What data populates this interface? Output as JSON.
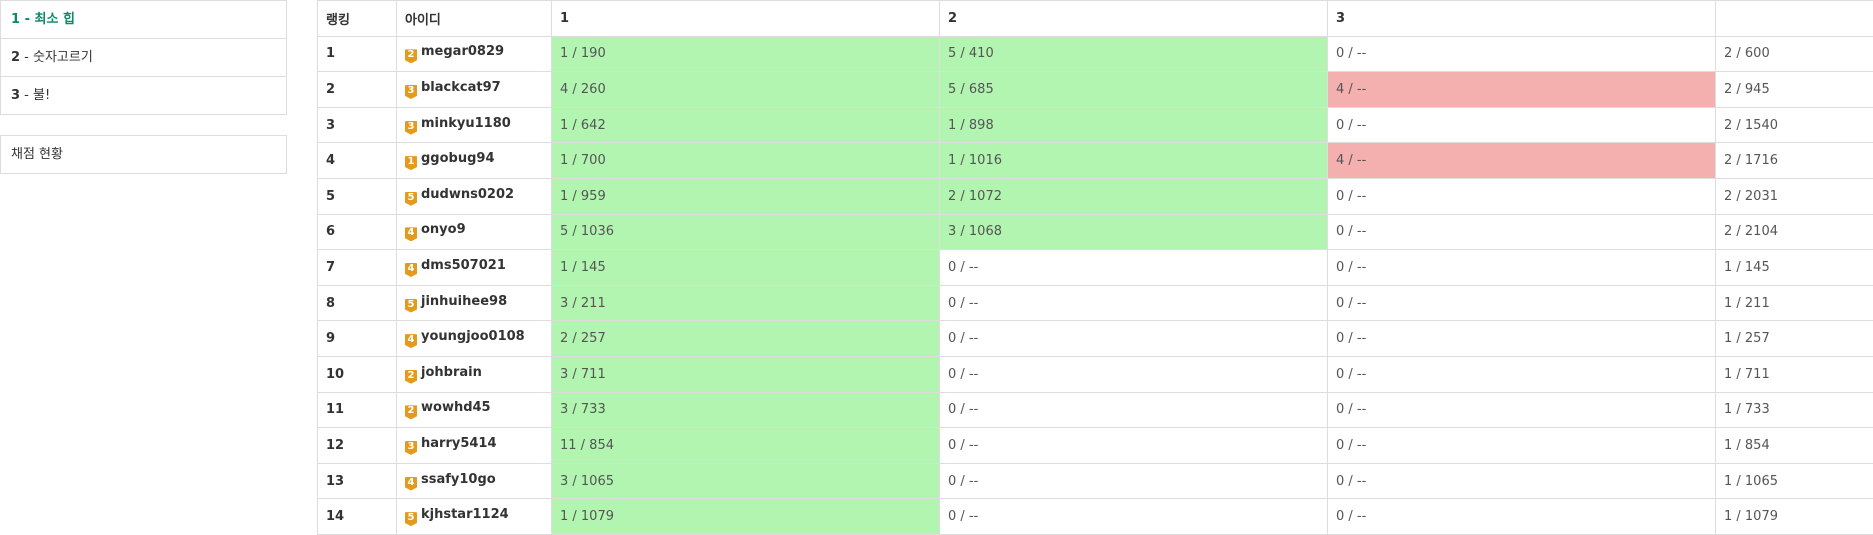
{
  "sidebar": {
    "problems": [
      {
        "num": "1",
        "sep": " - ",
        "label": "최소 힙"
      },
      {
        "num": "2",
        "sep": " - ",
        "label": "숫자고르기"
      },
      {
        "num": "3",
        "sep": " - ",
        "label": "불!"
      }
    ],
    "status_label": "채점 현황"
  },
  "table": {
    "headers": {
      "rank": "랭킹",
      "id": "아이디",
      "p1": "1",
      "p2": "2",
      "p3": "3",
      "total": ""
    },
    "rows": [
      {
        "rank": "1",
        "tier": "2",
        "id": "megar0829",
        "p1": "1 / 190",
        "p2": "5 / 410",
        "p3": "0 / --",
        "total": "2 / 600",
        "s1": "ok",
        "s2": "ok",
        "s3": ""
      },
      {
        "rank": "2",
        "tier": "3",
        "id": "blackcat97",
        "p1": "4 / 260",
        "p2": "5 / 685",
        "p3": "4 / --",
        "total": "2 / 945",
        "s1": "ok",
        "s2": "ok",
        "s3": "fail"
      },
      {
        "rank": "3",
        "tier": "3",
        "id": "minkyu1180",
        "p1": "1 / 642",
        "p2": "1 / 898",
        "p3": "0 / --",
        "total": "2 / 1540",
        "s1": "ok",
        "s2": "ok",
        "s3": ""
      },
      {
        "rank": "4",
        "tier": "1",
        "id": "ggobug94",
        "p1": "1 / 700",
        "p2": "1 / 1016",
        "p3": "4 / --",
        "total": "2 / 1716",
        "s1": "ok",
        "s2": "ok",
        "s3": "fail"
      },
      {
        "rank": "5",
        "tier": "5",
        "id": "dudwns0202",
        "p1": "1 / 959",
        "p2": "2 / 1072",
        "p3": "0 / --",
        "total": "2 / 2031",
        "s1": "ok",
        "s2": "ok",
        "s3": ""
      },
      {
        "rank": "6",
        "tier": "4",
        "id": "onyo9",
        "p1": "5 / 1036",
        "p2": "3 / 1068",
        "p3": "0 / --",
        "total": "2 / 2104",
        "s1": "ok",
        "s2": "ok",
        "s3": ""
      },
      {
        "rank": "7",
        "tier": "4",
        "id": "dms507021",
        "p1": "1 / 145",
        "p2": "0 / --",
        "p3": "0 / --",
        "total": "1 / 145",
        "s1": "ok",
        "s2": "",
        "s3": ""
      },
      {
        "rank": "8",
        "tier": "5",
        "id": "jinhuihee98",
        "p1": "3 / 211",
        "p2": "0 / --",
        "p3": "0 / --",
        "total": "1 / 211",
        "s1": "ok",
        "s2": "",
        "s3": ""
      },
      {
        "rank": "9",
        "tier": "4",
        "id": "youngjoo0108",
        "p1": "2 / 257",
        "p2": "0 / --",
        "p3": "0 / --",
        "total": "1 / 257",
        "s1": "ok",
        "s2": "",
        "s3": ""
      },
      {
        "rank": "10",
        "tier": "2",
        "id": "johbrain",
        "p1": "3 / 711",
        "p2": "0 / --",
        "p3": "0 / --",
        "total": "1 / 711",
        "s1": "ok",
        "s2": "",
        "s3": ""
      },
      {
        "rank": "11",
        "tier": "2",
        "id": "wowhd45",
        "p1": "3 / 733",
        "p2": "0 / --",
        "p3": "0 / --",
        "total": "1 / 733",
        "s1": "ok",
        "s2": "",
        "s3": ""
      },
      {
        "rank": "12",
        "tier": "3",
        "id": "harry5414",
        "p1": "11 / 854",
        "p2": "0 / --",
        "p3": "0 / --",
        "total": "1 / 854",
        "s1": "ok",
        "s2": "",
        "s3": ""
      },
      {
        "rank": "13",
        "tier": "4",
        "id": "ssafy10go",
        "p1": "3 / 1065",
        "p2": "0 / --",
        "p3": "0 / --",
        "total": "1 / 1065",
        "s1": "ok",
        "s2": "",
        "s3": ""
      },
      {
        "rank": "14",
        "tier": "5",
        "id": "kjhstar1124",
        "p1": "1 / 1079",
        "p2": "0 / --",
        "p3": "0 / --",
        "total": "1 / 1079",
        "s1": "ok",
        "s2": "",
        "s3": ""
      }
    ]
  },
  "colors": {
    "active_link": "#0a8a6a",
    "solved": "#b1f5b0",
    "failed": "#f4afaf",
    "tier_badge": "#e49b1b"
  }
}
